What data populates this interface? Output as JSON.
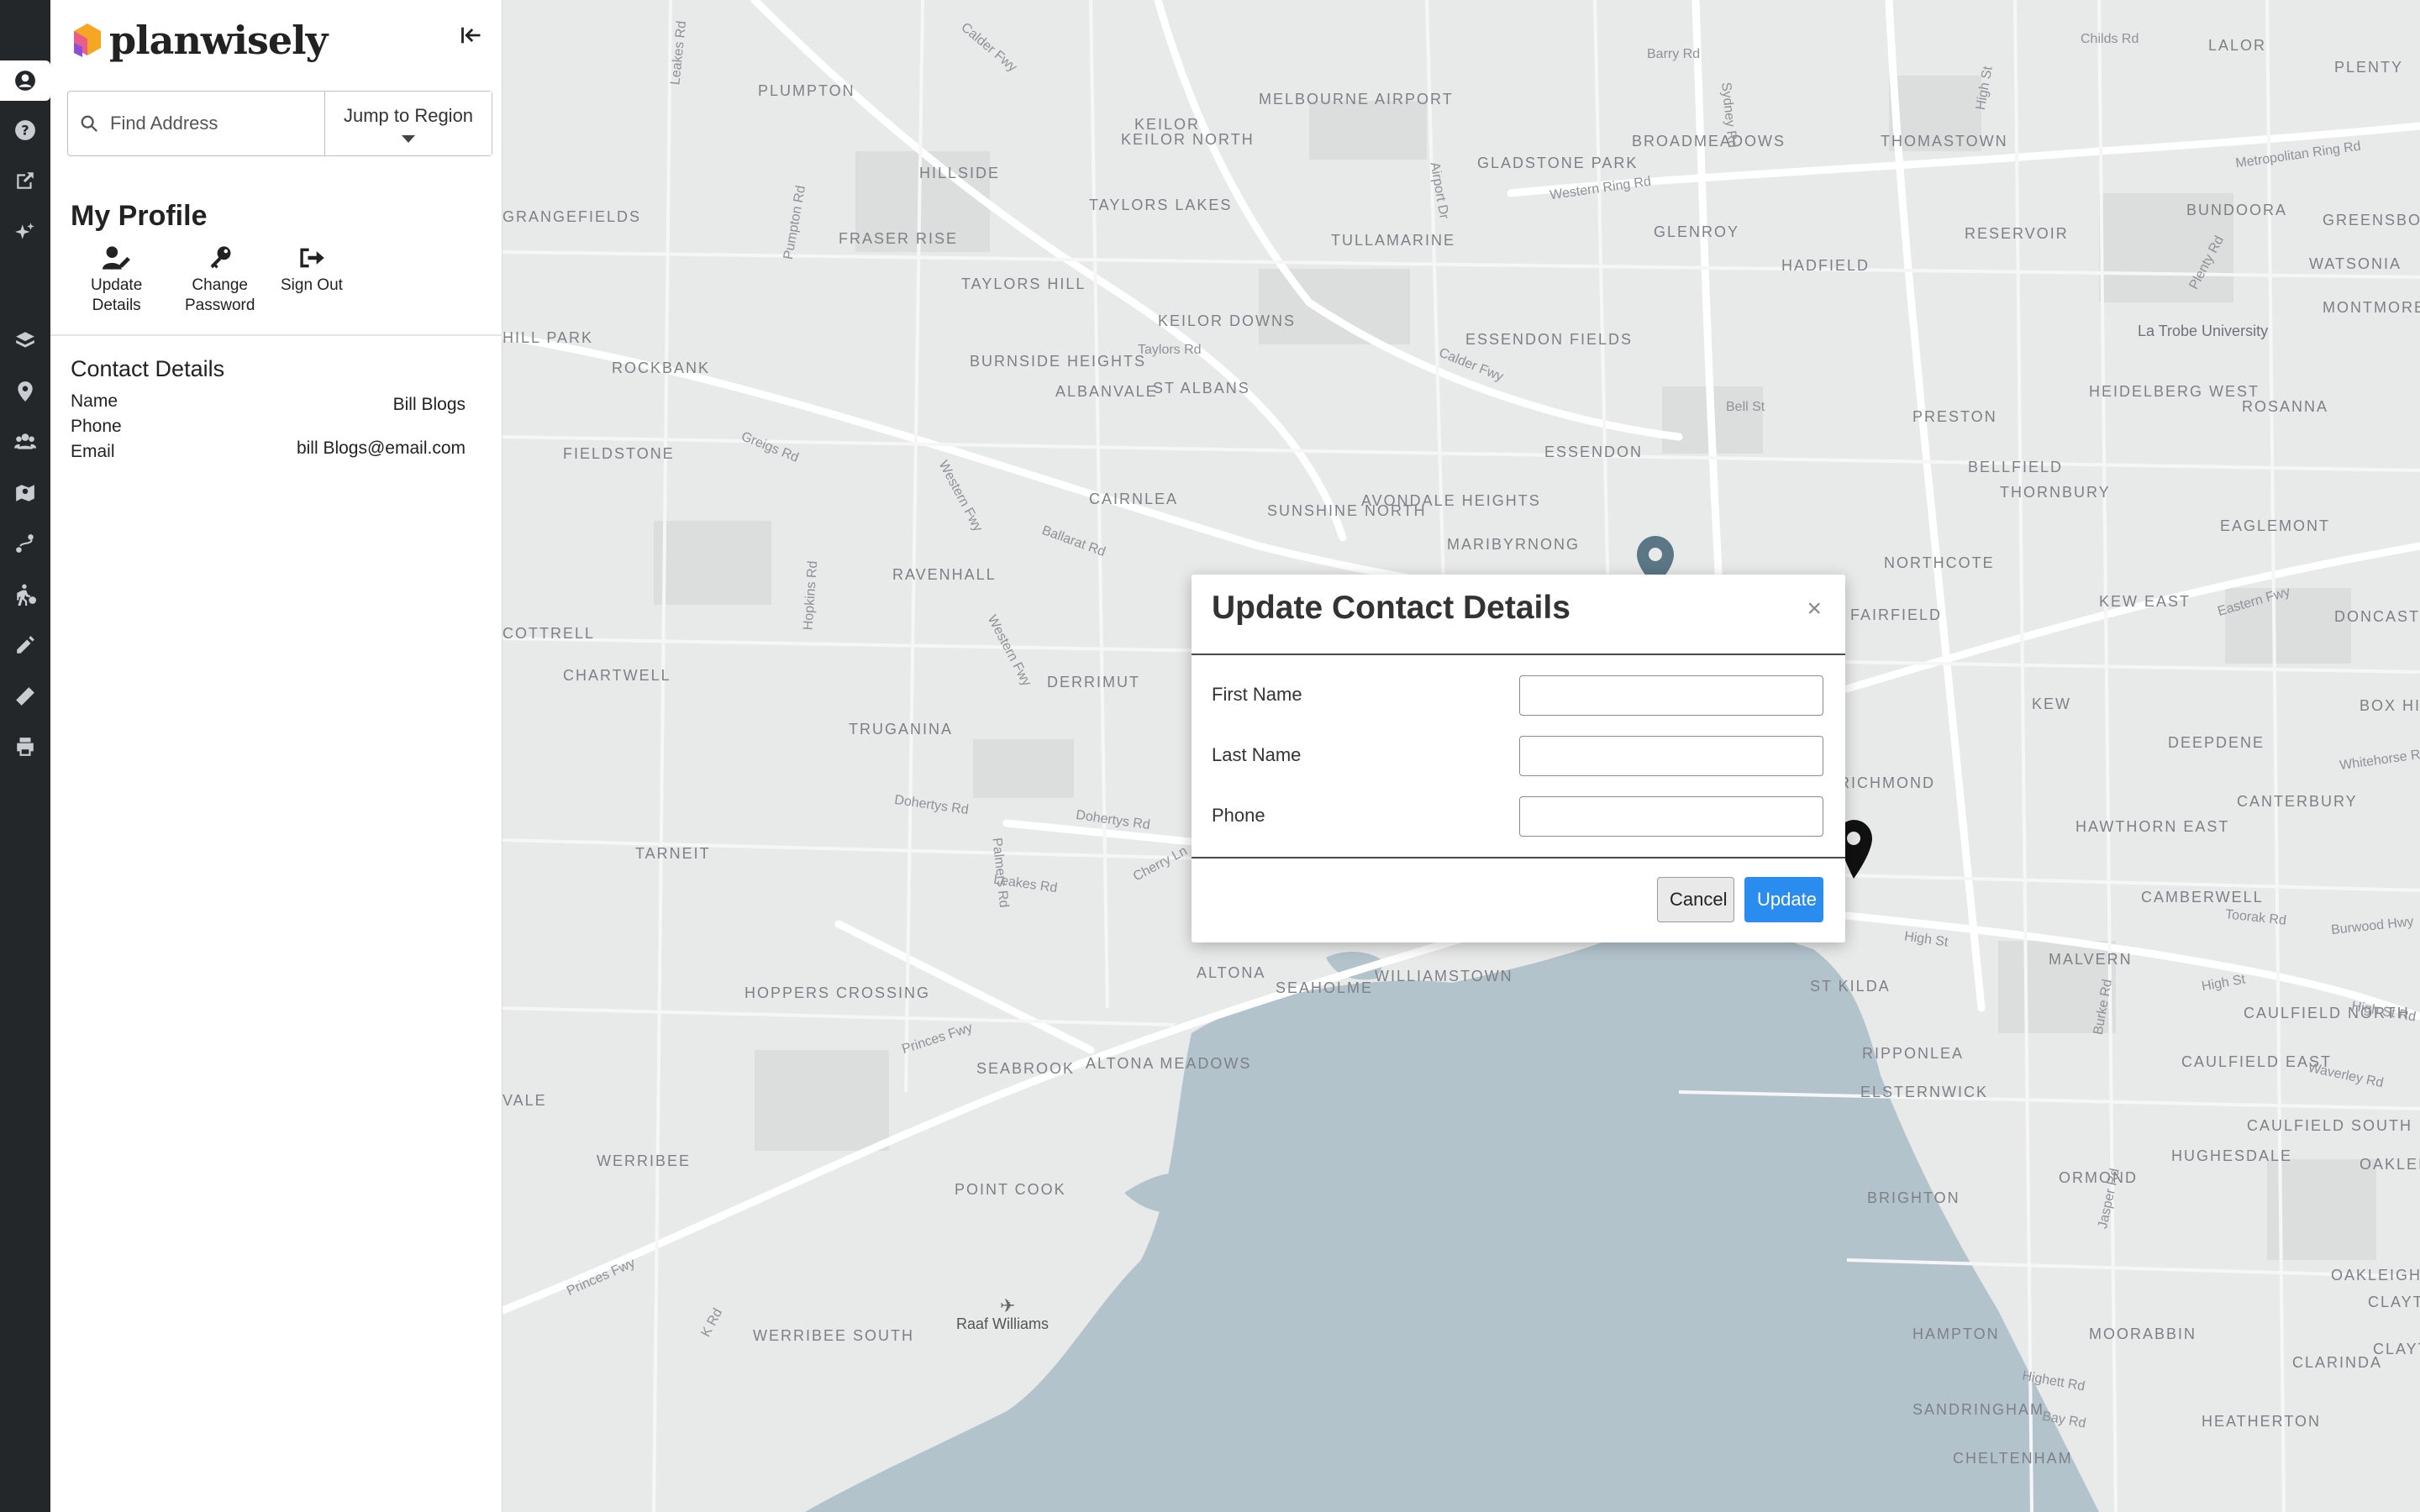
{
  "brand": {
    "name": "planwisely"
  },
  "search": {
    "placeholder": "Find Address",
    "region_label": "Jump to Region"
  },
  "profile": {
    "title": "My Profile",
    "actions": [
      {
        "label_1": "Update",
        "label_2": "Details",
        "icon": "user-edit-icon"
      },
      {
        "label_1": "Change",
        "label_2": "Password",
        "icon": "key-icon"
      },
      {
        "label_1": "Sign Out",
        "label_2": "",
        "icon": "sign-out-icon"
      }
    ]
  },
  "contact": {
    "title": "Contact Details",
    "rows": [
      {
        "label": "Name",
        "value": "Bill Blogs"
      },
      {
        "label": "Phone",
        "value": ""
      },
      {
        "label": "Email",
        "value": "bill Blogs@email.com"
      }
    ]
  },
  "rail": [
    "user-circle-icon",
    "help-icon",
    "share-icon",
    "sparkles-icon",
    "layers-icon",
    "location-pin-icon",
    "users-icon",
    "map-marker-icon",
    "route-icon",
    "walking-icon",
    "pencil-icon",
    "ruler-icon",
    "print-icon"
  ],
  "map": {
    "places": [
      "KEILOR NORTH",
      "MELBOURNE AIRPORT",
      "GLADSTONE PARK",
      "BROADMEADOWS",
      "THOMASTOWN",
      "LALOR",
      "PLENTY",
      "HILLSIDE",
      "TAYLORS LAKES",
      "TULLAMARINE",
      "GLENROY",
      "HADFIELD",
      "RESERVOIR",
      "BUNDOORA",
      "WATSONIA",
      "GREENSBOROUGH",
      "MONTMORENCY",
      "PLUMPTON",
      "GRANGEFIELDS",
      "FRASER RISE",
      "TAYLORS HILL",
      "KEILOR DOWNS",
      "ESSENDON FIELDS",
      "PRESTON",
      "HEIDELBERG WEST",
      "ROSANNA",
      "La Trobe University",
      "HILL PARK",
      "ROCKBANK",
      "BURNSIDE HEIGHTS",
      "ALBANVALE",
      "ST ALBANS",
      "FIELDSTONE",
      "ESSENDON",
      "BELLFIELD",
      "CAIRNLEA",
      "SUNSHINE NORTH",
      "AVONDALE HEIGHTS",
      "THORNBURY",
      "EAGLEMONT",
      "MARIBYRNONG",
      "NORTHCOTE",
      "RAVENHALL",
      "COTTRELL",
      "FAIRFIELD",
      "KEW EAST",
      "DONCASTER",
      "CHARTWELL",
      "DERRIMUT",
      "KEW",
      "BOX HILL",
      "TRUGANINA",
      "DEEPDENE",
      "RICHMOND",
      "CANTERBURY",
      "TARNEIT",
      "HAWTHORN EAST",
      "CAMBERWELL",
      "HOPPERS CROSSING",
      "ALTONA",
      "SEAHOLME",
      "WILLIAMSTOWN",
      "ST KILDA",
      "MALVERN",
      "CAULFIELD NORTH",
      "SEABROOK",
      "ALTONA MEADOWS",
      "RIPPONLEA",
      "CAULFIELD EAST",
      "WERRIBEE",
      "ELSTERNWICK",
      "CAULFIELD SOUTH",
      "HUGHESDALE",
      "OAKLEIGH EAST",
      "POINT COOK",
      "ORMOND",
      "BRIGHTON",
      "OAKLEIGH SOUTH",
      "CLAYTON SOUTH",
      "WERRIBEE SOUTH",
      "Raaf Williams",
      "HAMPTON",
      "MOORABBIN",
      "CLARINDA",
      "SANDRINGHAM",
      "HEATHERTON",
      "CHELTENHAM",
      "CLAYTON",
      "VALE"
    ],
    "roads": [
      "Calder Fwy",
      "Barry Rd",
      "Childs Rd",
      "Metropolitan Ring Rd",
      "Western Ring Rd",
      "Sydney Rd",
      "High St",
      "Airport Dr",
      "Taylors Rd",
      "Calder Fwy",
      "Bell St",
      "Greigs Rd",
      "Western Fwy",
      "Ballarat Rd",
      "Hopkins Rd",
      "Western Fwy",
      "Dohertys Rd",
      "Dohertys Rd",
      "Palmers Rd",
      "Leakes Rd",
      "Cherry Ln",
      "Princes Fwy",
      "Princes Fwy",
      "K Rd",
      "Eastern Fwy",
      "Whitehorse Rd",
      "Toorak Rd",
      "Burwood Hwy",
      "High St",
      "High St",
      "Waverley Rd",
      "High St Rd",
      "Burke Rd",
      "Jasper Rd",
      "Highett Rd",
      "Bay Rd",
      "Plenty Rd",
      "Pumpton Rd",
      "Leakes Rd"
    ]
  },
  "modal": {
    "title": "Update Contact Details",
    "close": "×",
    "fields": [
      {
        "label": "First Name",
        "value": ""
      },
      {
        "label": "Last Name",
        "value": ""
      },
      {
        "label": "Phone",
        "value": ""
      }
    ],
    "cancel_label": "Cancel",
    "update_label": "Update"
  },
  "colors": {
    "rail_bg": "#23272a",
    "primary": "#2b8cf0",
    "water": "#b3c3cc",
    "map_bg": "#e8e9e9"
  }
}
